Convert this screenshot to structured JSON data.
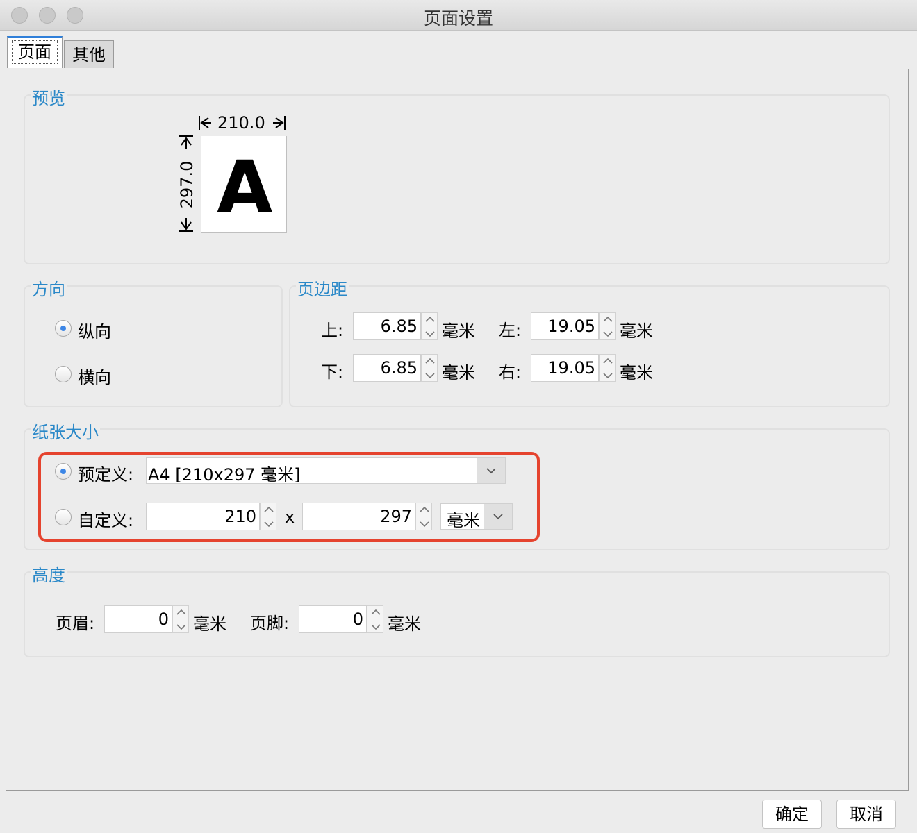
{
  "window": {
    "title": "页面设置"
  },
  "tabs": [
    {
      "label": "页面"
    },
    {
      "label": "其他"
    }
  ],
  "preview": {
    "legend": "预览",
    "width": "210.0",
    "height": "297.0",
    "glyph": "A"
  },
  "orientation": {
    "legend": "方向",
    "options": [
      {
        "label": "纵向",
        "selected": true
      },
      {
        "label": "横向",
        "selected": false
      }
    ]
  },
  "margins": {
    "legend": "页边距",
    "top_label": "上:",
    "top_value": "6.85",
    "bottom_label": "下:",
    "bottom_value": "6.85",
    "left_label": "左:",
    "left_value": "19.05",
    "right_label": "右:",
    "right_value": "19.05",
    "unit": "毫米"
  },
  "paper_size": {
    "legend": "纸张大小",
    "predefined_label": "预定义:",
    "predefined_value": "A4 [210x297 毫米]",
    "custom_label": "自定义:",
    "custom_width": "210",
    "times": "x",
    "custom_height": "297",
    "custom_unit": "毫米"
  },
  "height": {
    "legend": "高度",
    "header_label": "页眉:",
    "header_value": "0",
    "footer_label": "页脚:",
    "footer_value": "0",
    "unit": "毫米"
  },
  "buttons": {
    "ok": "确定",
    "cancel": "取消"
  },
  "colors": {
    "accent": "#2a88c8",
    "highlight": "#e5432e",
    "radio_selected": "#3c86e6"
  }
}
